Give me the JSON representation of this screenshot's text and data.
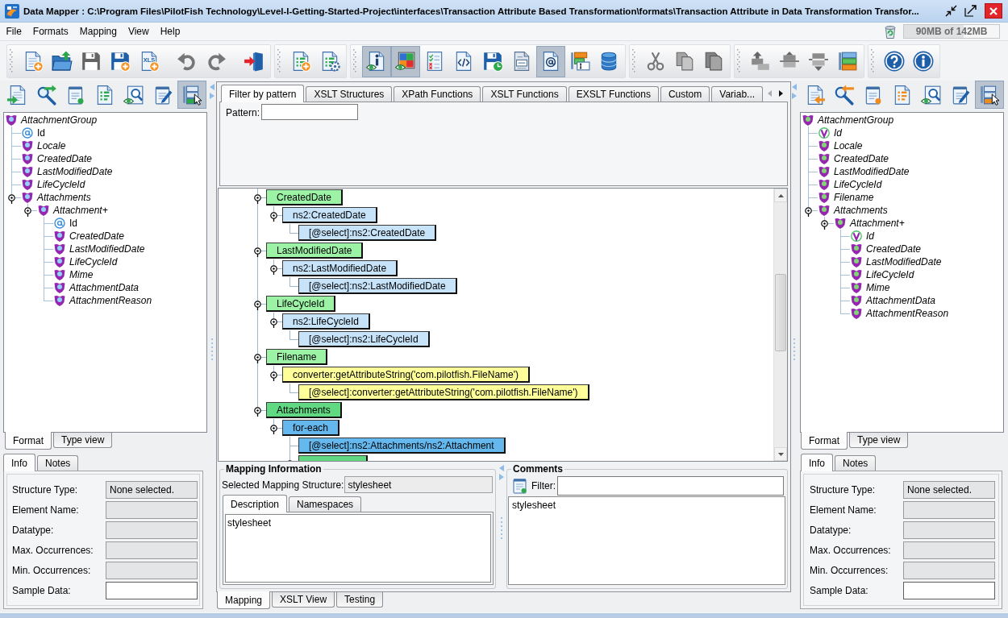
{
  "window": {
    "title": "Data Mapper : C:\\Program Files\\PilotFish Technology\\Level-I-Getting-Started-Project\\interfaces\\Transaction Attribute Based Transformation\\formats\\Transaction Attribute in Data Transformation Transfor..."
  },
  "menu": [
    {
      "label": "File"
    },
    {
      "label": "Formats"
    },
    {
      "label": "Mapping"
    },
    {
      "label": "View"
    },
    {
      "label": "Help"
    }
  ],
  "memory": {
    "reading": "90MB of 142MB",
    "level": 0.63
  },
  "toolbar": {
    "groups": [
      [
        [
          {
            "kind": "new",
            "selected": false,
            "disabled": false
          },
          {
            "kind": "open",
            "selected": false,
            "disabled": false
          },
          {
            "kind": "save",
            "selected": false,
            "disabled": true
          },
          {
            "kind": "save-as",
            "selected": false,
            "disabled": false
          },
          {
            "kind": "xls",
            "label": "XLS",
            "selected": false,
            "disabled": false
          }
        ],
        [
          {
            "kind": "undo",
            "selected": false,
            "disabled": true
          },
          {
            "kind": "redo",
            "selected": false,
            "disabled": true
          }
        ],
        [
          {
            "kind": "exit",
            "selected": false,
            "disabled": false
          }
        ]
      ],
      [
        [
          {
            "kind": "add-mapping",
            "selected": false,
            "disabled": false
          },
          {
            "kind": "configure",
            "selected": false,
            "disabled": false
          }
        ]
      ],
      [
        [
          {
            "kind": "info-view",
            "selected": true,
            "disabled": false
          },
          {
            "kind": "color-view",
            "selected": true,
            "disabled": false
          },
          {
            "kind": "checklist",
            "selected": false,
            "disabled": false
          },
          {
            "kind": "code",
            "selected": false,
            "disabled": false
          },
          {
            "kind": "save-schedule",
            "selected": false,
            "disabled": false
          },
          {
            "kind": "document",
            "selected": false,
            "disabled": false
          },
          {
            "kind": "at-document",
            "selected": true,
            "disabled": false
          },
          {
            "kind": "tree-form",
            "selected": false,
            "disabled": false
          },
          {
            "kind": "database",
            "selected": false,
            "disabled": false
          }
        ]
      ],
      [
        [
          {
            "kind": "cut",
            "selected": false,
            "disabled": true
          },
          {
            "kind": "copy",
            "selected": false,
            "disabled": true
          },
          {
            "kind": "paste",
            "selected": false,
            "disabled": true
          }
        ]
      ],
      [
        [
          {
            "kind": "struct-up",
            "selected": false,
            "disabled": true
          },
          {
            "kind": "struct-mid",
            "selected": false,
            "disabled": true
          },
          {
            "kind": "struct-down",
            "selected": false,
            "disabled": true
          },
          {
            "kind": "struct-color",
            "selected": false,
            "disabled": false
          }
        ]
      ],
      [
        [
          {
            "kind": "help",
            "selected": false,
            "disabled": false
          },
          {
            "kind": "about",
            "selected": false,
            "disabled": false
          }
        ]
      ]
    ]
  },
  "source_panel": {
    "toolbar": [
      {
        "kind": "import",
        "selected": false
      },
      {
        "kind": "find",
        "selected": false
      },
      {
        "kind": "notes",
        "selected": false
      },
      {
        "kind": "list",
        "selected": false
      },
      {
        "kind": "preview",
        "selected": false
      },
      {
        "kind": "edit",
        "selected": false
      },
      {
        "kind": "tree-select",
        "selected": true
      }
    ],
    "tree": [
      {
        "label": "AttachmentGroup",
        "kind": "element",
        "optional": true,
        "children": [
          {
            "label": "Id",
            "kind": "attribute",
            "optional": false
          },
          {
            "label": "Locale",
            "kind": "element",
            "optional": true
          },
          {
            "label": "CreatedDate",
            "kind": "element",
            "optional": true
          },
          {
            "label": "LastModifiedDate",
            "kind": "element",
            "optional": true
          },
          {
            "label": "LifeCycleId",
            "kind": "element",
            "optional": true
          },
          {
            "label": "Attachments",
            "kind": "element",
            "optional": true,
            "expanded": true,
            "children": [
              {
                "label": "Attachment+",
                "kind": "element",
                "optional": true,
                "expanded": true,
                "children": [
                  {
                    "label": "Id",
                    "kind": "attribute",
                    "optional": false
                  },
                  {
                    "label": "CreatedDate",
                    "kind": "element",
                    "optional": true
                  },
                  {
                    "label": "LastModifiedDate",
                    "kind": "element",
                    "optional": true
                  },
                  {
                    "label": "LifeCycleId",
                    "kind": "element",
                    "optional": true
                  },
                  {
                    "label": "Mime",
                    "kind": "element",
                    "optional": true
                  },
                  {
                    "label": "AttachmentData",
                    "kind": "element",
                    "optional": true
                  },
                  {
                    "label": "AttachmentReason",
                    "kind": "element",
                    "optional": true
                  }
                ]
              }
            ]
          }
        ]
      }
    ],
    "view_tabs": [
      {
        "label": "Format",
        "selected": true
      },
      {
        "label": "Type view",
        "selected": false
      }
    ],
    "info_tabs": [
      {
        "label": "Info",
        "selected": true
      },
      {
        "label": "Notes",
        "selected": false
      }
    ],
    "fields": [
      {
        "label": "Structure Type:",
        "value": "None selected.",
        "editable": false
      },
      {
        "label": "Element Name:",
        "editable": false
      },
      {
        "label": "Datatype:",
        "editable": false
      },
      {
        "label": "Max. Occurrences:",
        "editable": false
      },
      {
        "label": "Min. Occurrences:",
        "editable": false
      },
      {
        "label": "Sample Data:",
        "editable": true
      }
    ]
  },
  "filter": {
    "tabs": [
      {
        "label": "Filter by pattern",
        "selected": true
      },
      {
        "label": "XSLT Structures",
        "selected": false
      },
      {
        "label": "XPath Functions",
        "selected": false
      },
      {
        "label": "XSLT Functions",
        "selected": false
      },
      {
        "label": "EXSLT Functions",
        "selected": false
      },
      {
        "label": "Custom",
        "selected": false
      },
      {
        "label": "Variab...",
        "selected": false
      }
    ],
    "scroll_buttons": [
      {
        "kind": "back",
        "disabled": true
      },
      {
        "kind": "forward",
        "disabled": false
      }
    ],
    "pattern_label": "Pattern:"
  },
  "mapping_tree": {
    "nodes": [
      {
        "label": "CreatedDate",
        "color": "#9cf3a6",
        "expanded": true,
        "children": [
          {
            "label": "ns2:CreatedDate",
            "color": "#c6e3fa",
            "expanded": true,
            "children": [
              {
                "label": "[@select]:ns2:CreatedDate",
                "color": "#c6e3fa"
              }
            ]
          }
        ]
      },
      {
        "label": "LastModifiedDate",
        "color": "#9cf3a6",
        "expanded": true,
        "children": [
          {
            "label": "ns2:LastModifiedDate",
            "color": "#c6e3fa",
            "expanded": true,
            "children": [
              {
                "label": "[@select]:ns2:LastModifiedDate",
                "color": "#c6e3fa"
              }
            ]
          }
        ]
      },
      {
        "label": "LifeCycleId",
        "color": "#9cf3a6",
        "expanded": true,
        "children": [
          {
            "label": "ns2:LifeCycleId",
            "color": "#c6e3fa",
            "expanded": true,
            "children": [
              {
                "label": "[@select]:ns2:LifeCycleId",
                "color": "#c6e3fa"
              }
            ]
          }
        ]
      },
      {
        "label": "Filename",
        "color": "#9cf3a6",
        "expanded": true,
        "children": [
          {
            "label": "converter:getAttributeString('com.pilotfish.FileName')",
            "color": "#ffff99",
            "expanded": true,
            "children": [
              {
                "label": "[@select]:converter:getAttributeString('com.pilotfish.FileName')",
                "color": "#ffff99"
              }
            ]
          }
        ]
      },
      {
        "label": "Attachments",
        "color": "#60d982",
        "expanded": true,
        "children": [
          {
            "label": "for-each",
            "color": "#64b8ee",
            "expanded": true,
            "children": [
              {
                "label": "[@select]:ns2:Attachments/ns2:Attachment",
                "color": "#64b8ee"
              },
              {
                "color": "#60d982",
                "expanded": true
              }
            ]
          }
        ]
      }
    ]
  },
  "mapping_info": {
    "title": "Mapping Information",
    "structure_label": "Selected Mapping Structure:",
    "structure_value": "stylesheet",
    "tabs": [
      {
        "label": "Description",
        "selected": true
      },
      {
        "label": "Namespaces",
        "selected": false
      }
    ],
    "description": "stylesheet"
  },
  "comments": {
    "title": "Comments",
    "filter_label": "Filter:",
    "text": "stylesheet"
  },
  "view_tabs": [
    {
      "label": "Mapping",
      "selected": true
    },
    {
      "label": "XSLT View",
      "selected": false
    },
    {
      "label": "Testing",
      "selected": false
    }
  ],
  "target_panel": {
    "toolbar": [
      {
        "kind": "import",
        "selected": false
      },
      {
        "kind": "find",
        "selected": false
      },
      {
        "kind": "notes",
        "selected": false
      },
      {
        "kind": "list",
        "selected": false
      },
      {
        "kind": "preview",
        "selected": false
      },
      {
        "kind": "edit",
        "selected": false
      },
      {
        "kind": "tree-select",
        "selected": true
      }
    ],
    "tree": [
      {
        "label": "AttachmentGroup",
        "kind": "element",
        "optional": true,
        "children": [
          {
            "label": "Id",
            "kind": "attribute",
            "optional": true
          },
          {
            "label": "Locale",
            "kind": "element",
            "optional": true
          },
          {
            "label": "CreatedDate",
            "kind": "element",
            "optional": true
          },
          {
            "label": "LastModifiedDate",
            "kind": "element",
            "optional": true
          },
          {
            "label": "LifeCycleId",
            "kind": "element",
            "optional": true
          },
          {
            "label": "Filename",
            "kind": "element",
            "optional": true
          },
          {
            "label": "Attachments",
            "kind": "element",
            "optional": true,
            "expanded": true,
            "children": [
              {
                "label": "Attachment+",
                "kind": "element",
                "optional": true,
                "expanded": true,
                "children": [
                  {
                    "label": "Id",
                    "kind": "attribute",
                    "optional": true
                  },
                  {
                    "label": "CreatedDate",
                    "kind": "element",
                    "optional": true
                  },
                  {
                    "label": "LastModifiedDate",
                    "kind": "element",
                    "optional": true
                  },
                  {
                    "label": "LifeCycleId",
                    "kind": "element",
                    "optional": true
                  },
                  {
                    "label": "Mime",
                    "kind": "element",
                    "optional": true
                  },
                  {
                    "label": "AttachmentData",
                    "kind": "element",
                    "optional": true
                  },
                  {
                    "label": "AttachmentReason",
                    "kind": "element",
                    "optional": true
                  }
                ]
              }
            ]
          }
        ]
      }
    ],
    "view_tabs": [
      {
        "label": "Format",
        "selected": true
      },
      {
        "label": "Type view",
        "selected": false
      }
    ],
    "info_tabs": [
      {
        "label": "Info",
        "selected": true
      },
      {
        "label": "Notes",
        "selected": false
      }
    ],
    "fields": [
      {
        "label": "Structure Type:",
        "value": "None selected.",
        "editable": false
      },
      {
        "label": "Element Name:",
        "editable": false
      },
      {
        "label": "Datatype:",
        "editable": false
      },
      {
        "label": "Max. Occurrences:",
        "editable": false
      },
      {
        "label": "Min. Occurrences:",
        "editable": false
      },
      {
        "label": "Sample Data:",
        "editable": true
      }
    ]
  }
}
